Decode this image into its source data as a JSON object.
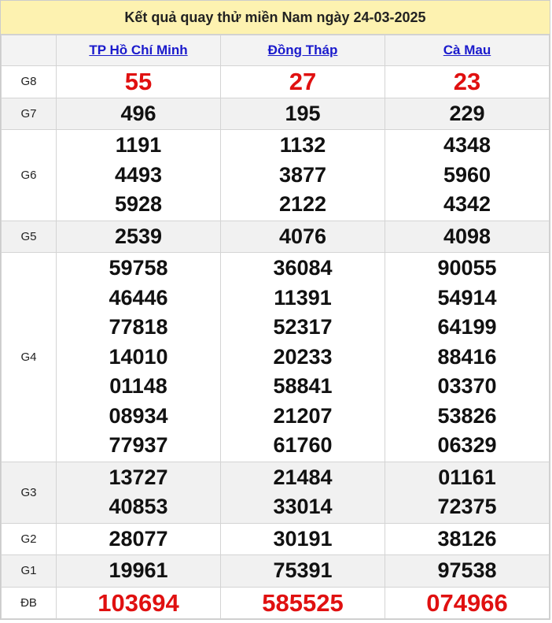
{
  "title": "Kết quả quay thử miền Nam ngày 24-03-2025",
  "provinces": [
    "TP Hồ Chí Minh",
    "Đồng Tháp",
    "Cà Mau"
  ],
  "colors": {
    "accent_red": "#e01010",
    "header_bg": "#fdf2b0",
    "link": "#1a1acc"
  },
  "prizes": [
    {
      "label": "G8",
      "red": true,
      "values": [
        [
          "55"
        ],
        [
          "27"
        ],
        [
          "23"
        ]
      ]
    },
    {
      "label": "G7",
      "red": false,
      "values": [
        [
          "496"
        ],
        [
          "195"
        ],
        [
          "229"
        ]
      ]
    },
    {
      "label": "G6",
      "red": false,
      "values": [
        [
          "1191",
          "4493",
          "5928"
        ],
        [
          "1132",
          "3877",
          "2122"
        ],
        [
          "4348",
          "5960",
          "4342"
        ]
      ]
    },
    {
      "label": "G5",
      "red": false,
      "values": [
        [
          "2539"
        ],
        [
          "4076"
        ],
        [
          "4098"
        ]
      ]
    },
    {
      "label": "G4",
      "red": false,
      "values": [
        [
          "59758",
          "46446",
          "77818",
          "14010",
          "01148",
          "08934",
          "77937"
        ],
        [
          "36084",
          "11391",
          "52317",
          "20233",
          "58841",
          "21207",
          "61760"
        ],
        [
          "90055",
          "54914",
          "64199",
          "88416",
          "03370",
          "53826",
          "06329"
        ]
      ]
    },
    {
      "label": "G3",
      "red": false,
      "values": [
        [
          "13727",
          "40853"
        ],
        [
          "21484",
          "33014"
        ],
        [
          "01161",
          "72375"
        ]
      ]
    },
    {
      "label": "G2",
      "red": false,
      "values": [
        [
          "28077"
        ],
        [
          "30191"
        ],
        [
          "38126"
        ]
      ]
    },
    {
      "label": "G1",
      "red": false,
      "values": [
        [
          "19961"
        ],
        [
          "75391"
        ],
        [
          "97538"
        ]
      ]
    },
    {
      "label": "ĐB",
      "red": true,
      "values": [
        [
          "103694"
        ],
        [
          "585525"
        ],
        [
          "074966"
        ]
      ]
    }
  ]
}
